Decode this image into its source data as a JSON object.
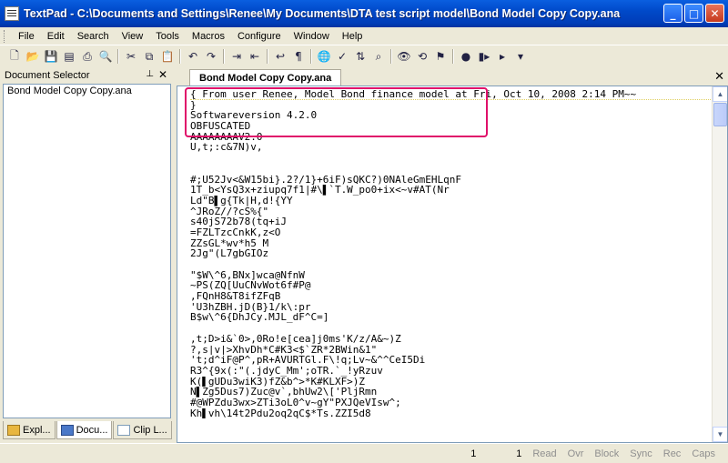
{
  "window": {
    "title": "TextPad - C:\\Documents and Settings\\Renee\\My Documents\\DTA test script model\\Bond Model Copy Copy.ana",
    "minimize": "_",
    "maximize": "□",
    "close": "✕"
  },
  "menu": [
    "File",
    "Edit",
    "Search",
    "View",
    "Tools",
    "Macros",
    "Configure",
    "Window",
    "Help"
  ],
  "toolbar_icons": [
    "new-icon",
    "open-icon",
    "save-icon",
    "save-all-icon",
    "print-icon",
    "print-preview-icon",
    "cut-icon",
    "copy-icon",
    "paste-icon",
    "undo-icon",
    "redo-icon",
    "indent-icon",
    "outdent-icon",
    "word-wrap-icon",
    "visible-spaces-icon",
    "web-icon",
    "spell-check-icon",
    "sort-icon",
    "find-icon",
    "find-next-icon",
    "replace-icon",
    "record-macro-icon",
    "play-macro-icon",
    "stop-macro-icon",
    "customize-icon"
  ],
  "selector": {
    "title": "Document Selector",
    "pin": "⊥",
    "close": "✕",
    "items": [
      "Bond Model Copy Copy.ana"
    ],
    "tabs": [
      {
        "label": "Expl...",
        "color": "#E8B640"
      },
      {
        "label": "Docu...",
        "color": "#4A78C8"
      },
      {
        "label": "Clip L...",
        "color": "#7F9DB9"
      }
    ]
  },
  "editor": {
    "tab_label": "Bond Model Copy Copy.ana",
    "close": "✕",
    "lines": [
      "{ From user Renee, Model Bond_finance_model at Fri, Oct 10, 2008 2:14 PM~~",
      "}",
      "Softwareversion 4.2.0",
      "OBFUSCATED",
      "AAAAAAAAV2.0",
      "U,t;:c&7N)v,",
      "",
      "",
      "#;U52Jv<&W15bi}.2?/1}+6iF)sQKC?)0NAleGmEHLqnF",
      "1T_b<YsQ3x+ziupq7f1|#\\▌`T.W_po0+ix<~v#AT(Nr",
      "Ld\"B▌g{Tk|H,d!{YY",
      "^JRoZ//?cS%{\"",
      "s40jS72b78(tq+iJ",
      "=FZLTzcCnkK,z<O",
      "ZZsGL*wv*h5_M",
      "2Jg\"(L7gbGIOz",
      "",
      "\"$W\\^6,BNx]wca@NfnW",
      "~PS(ZQ[UuCNvWot6f#P@",
      ",FQnH8&T8ifZFqB",
      "'U3hZBH.jD(B}1/k\\:pr",
      "B$w\\^6{DhJCy.MJL_dF^C=]",
      "",
      ",t;D>i&`0>,0Ro!e[cea]j0ms'K/z/A&~)Z",
      "?,s|v|>XhvDh*C#K3<$`ZR*2BWin&1\"",
      "'t;d^iF@P^,pR+AVURTGl.F\\!q;Lv~&^^CeI5Di",
      "R3^{9x(:\"(.jdyC_Mm';oTR.`_!yRzuv",
      "K(▌gUDu3wiK3)fZ&b^>*K#KLXF>)Z",
      "N▌Zg5Dus7)Zuc@v`,bhUw2\\['PljRmn",
      "#@WPZdu3wx>ZTi3oL0^v~gY\"PXJQeVIsw^;",
      "Kh▌vh\\14t2Pdu2oq2qC$*Ts.ZZI5d8"
    ]
  },
  "status": {
    "line": "1",
    "col": "1",
    "flags": [
      "Read",
      "Ovr",
      "Block",
      "Sync",
      "Rec",
      "Caps"
    ]
  },
  "colors": {
    "titlebar": "#0049C9",
    "highlight": "#E0106A",
    "chrome": "#ECE9D8"
  }
}
